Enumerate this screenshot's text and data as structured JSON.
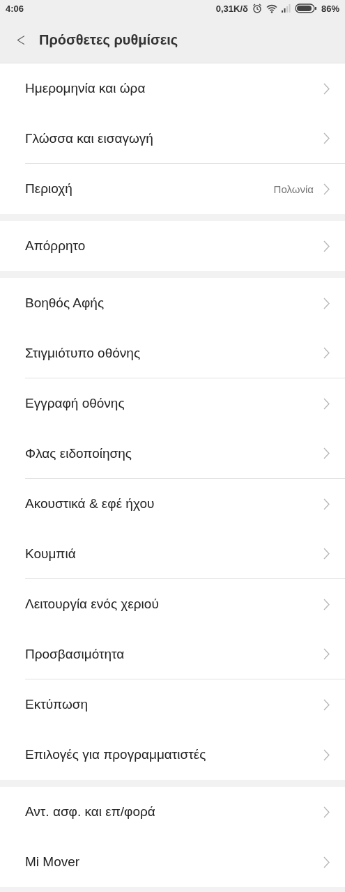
{
  "status_bar": {
    "time": "4:06",
    "speed": "0,31K/δ",
    "battery": "86%"
  },
  "header": {
    "back": "<",
    "title": "Πρόσθετες ρυθμίσεις"
  },
  "groups": [
    {
      "items": [
        {
          "label": "Ημερομηνία και ώρα"
        },
        {
          "label": "Γλώσσα και εισαγωγή"
        },
        {
          "label": "Περιοχή",
          "value": "Πολωνία"
        }
      ]
    },
    {
      "items": [
        {
          "label": "Απόρρητο"
        }
      ]
    },
    {
      "items": [
        {
          "label": "Βοηθός Αφής"
        },
        {
          "label": "Στιγμιότυπο οθόνης"
        },
        {
          "label": "Εγγραφή οθόνης"
        },
        {
          "label": "Φλας ειδοποίησης"
        },
        {
          "label": "Ακουστικά & εφέ ήχου"
        },
        {
          "label": "Κουμπιά"
        },
        {
          "label": "Λειτουργία ενός χεριού"
        },
        {
          "label": "Προσβασιμότητα"
        },
        {
          "label": "Εκτύπωση"
        },
        {
          "label": "Επιλογές για προγραμματιστές"
        }
      ]
    },
    {
      "items": [
        {
          "label": "Αντ. ασφ. και επ/φορά"
        },
        {
          "label": "Mi Mover"
        }
      ]
    }
  ]
}
